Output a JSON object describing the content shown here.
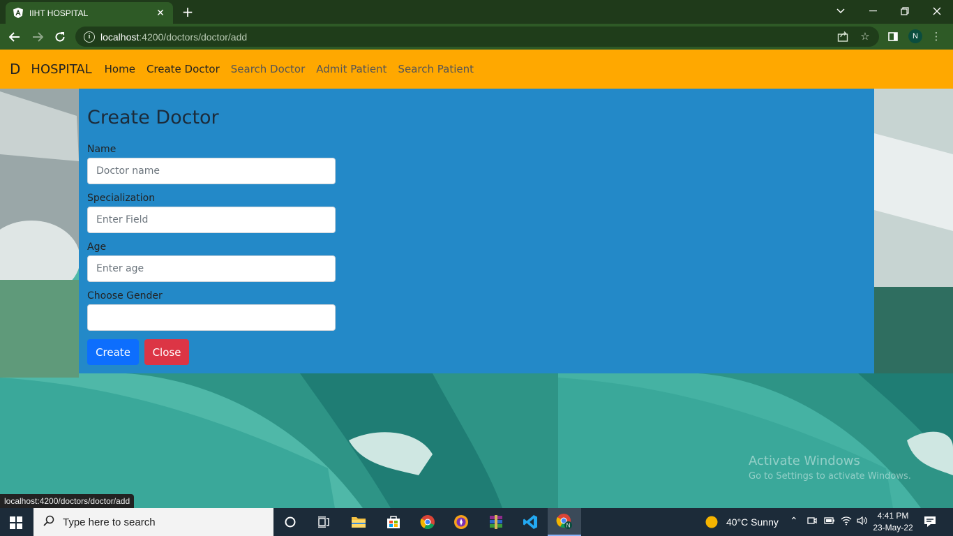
{
  "browser": {
    "tab_title": "IIHT HOSPITAL",
    "url_host": "localhost",
    "url_path": ":4200/doctors/doctor/add",
    "profile_initial": "N",
    "status_url": "localhost:4200/doctors/doctor/add"
  },
  "navbar": {
    "brand_letter": "D",
    "brand": "HOSPITAL",
    "links": [
      {
        "label": "Home"
      },
      {
        "label": "Create Doctor"
      },
      {
        "label": "Search Doctor"
      },
      {
        "label": "Admit Patient"
      },
      {
        "label": "Search Patient"
      }
    ]
  },
  "form": {
    "title": "Create Doctor",
    "name_label": "Name",
    "name_placeholder": "Doctor name",
    "spec_label": "Specialization",
    "spec_placeholder": "Enter Field",
    "age_label": "Age",
    "age_placeholder": "Enter age",
    "gender_label": "Choose Gender",
    "gender_value": "",
    "create_label": "Create",
    "close_label": "Close"
  },
  "watermark": {
    "line1": "Activate Windows",
    "line2": "Go to Settings to activate Windows."
  },
  "taskbar": {
    "search_placeholder": "Type here to search",
    "weather": "40°C  Sunny",
    "time": "4:41 PM",
    "date": "23-May-22",
    "profile_initial": "N"
  },
  "colors": {
    "navbar": "#ffa800",
    "panel": "#2389c8",
    "create_button": "#0d6efd",
    "close_button": "#dc3545"
  }
}
